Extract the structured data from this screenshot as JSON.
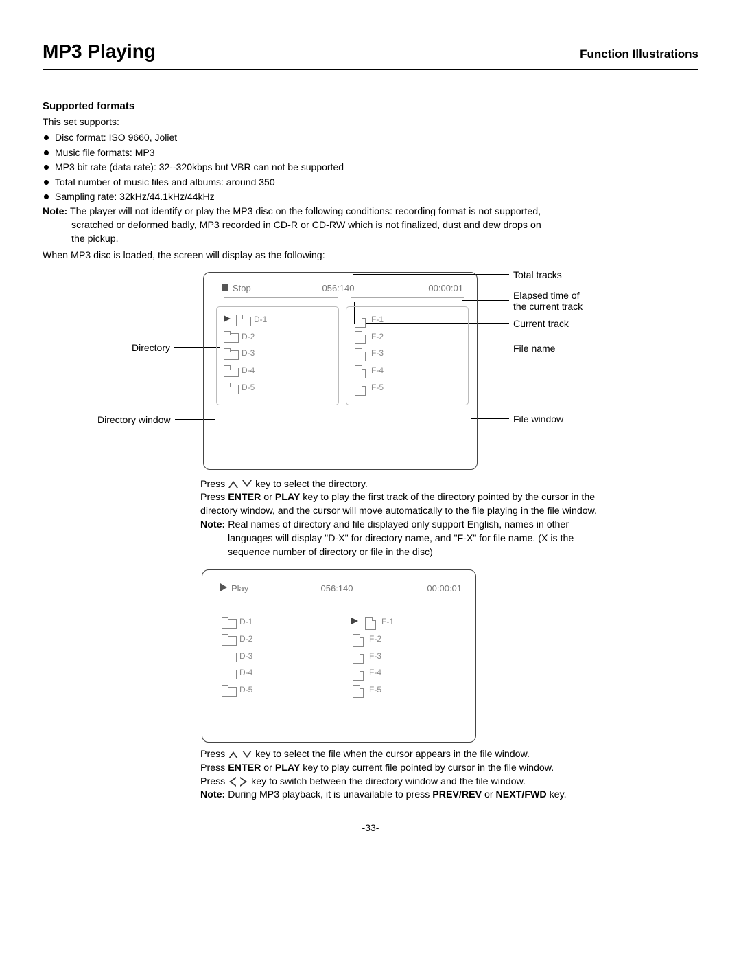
{
  "header": {
    "title": "MP3 Playing",
    "subtitle": "Function Illustrations"
  },
  "supported": {
    "heading": "Supported formats",
    "intro": "This set supports:",
    "items": [
      "Disc format: ISO 9660, Joliet",
      "Music file formats: MP3",
      "MP3 bit rate (data rate): 32--320kbps but VBR can not be supported",
      "Total number of music files and albums: around 350",
      "Sampling rate: 32kHz/44.1kHz/44kHz"
    ],
    "note_label": "Note:",
    "note_line1": "The player will not identify or play the MP3 disc on the following conditions: recording format is not supported,",
    "note_line2": "scratched or deformed badly, MP3 recorded in CD-R or CD-RW which is not finalized, dust and dew drops on",
    "note_line3": "the pickup.",
    "loaded_line": "When MP3 disc is loaded, the screen will display as the following:"
  },
  "labels": {
    "total_tracks": "Total tracks",
    "elapsed1": "Elapsed time of",
    "elapsed2": "the current track",
    "current_track": "Current track",
    "file_name": "File name",
    "file_window": "File window",
    "directory": "Directory",
    "directory_window": "Directory window"
  },
  "screen1": {
    "status": "Stop",
    "counter": "056:140",
    "time": "00:00:01",
    "dirs": [
      "D-1",
      "D-2",
      "D-3",
      "D-4",
      "D-5"
    ],
    "files": [
      "F-1",
      "F-2",
      "F-3",
      "F-4",
      "F-5"
    ]
  },
  "instr1": {
    "l1a": "Press ",
    "l1b": " key to select the directory.",
    "l2a": "Press ",
    "l2_enter": "ENTER",
    "l2_or": " or ",
    "l2_play": "PLAY",
    "l2b": " key to play the first track of the directory pointed by the cursor in the",
    "l3": "directory window, and the cursor will move automatically to the file playing in the file window.",
    "note_label": "Note:",
    "note1": " Real names of directory and file displayed only support English, names in other",
    "note2": "languages will display \"D-X\" for directory name, and \"F-X\" for file name. (X is the",
    "note3": "sequence number of directory or file in the disc)"
  },
  "screen2": {
    "status": "Play",
    "counter": "056:140",
    "time": "00:00:01",
    "dirs": [
      "D-1",
      "D-2",
      "D-3",
      "D-4",
      "D-5"
    ],
    "files": [
      "F-1",
      "F-2",
      "F-3",
      "F-4",
      "F-5"
    ]
  },
  "instr2": {
    "l1a": "Press ",
    "l1b": " key to select the file when the cursor appears in the file window.",
    "l2a": "Press ",
    "l2_enter": "ENTER",
    "l2_or": " or ",
    "l2_play": "PLAY",
    "l2b": " key to play current file pointed by cursor in the file window.",
    "l3a": "Press ",
    "l3b": " key to switch between the directory window and the file window.",
    "note_label": "Note:",
    "note1": " During MP3 playback, it is unavailable to press ",
    "prevrev": "PREV/REV",
    "or": " or ",
    "nextfwd": "NEXT/FWD",
    "note_end": " key."
  },
  "page_number": "-33-"
}
